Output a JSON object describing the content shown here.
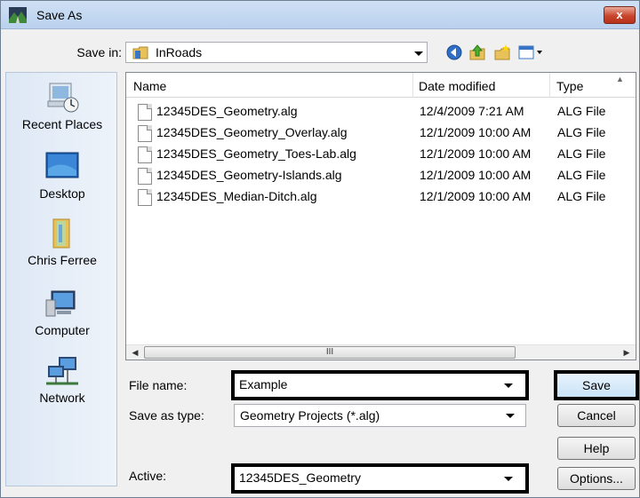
{
  "window": {
    "title": "Save As",
    "close_label": "x"
  },
  "save_in": {
    "label": "Save in:",
    "value": "InRoads"
  },
  "places": [
    {
      "label": "Recent Places",
      "icon": "recent-places-icon"
    },
    {
      "label": "Desktop",
      "icon": "desktop-icon"
    },
    {
      "label": "Chris Ferree",
      "icon": "user-folder-icon"
    },
    {
      "label": "Computer",
      "icon": "computer-icon"
    },
    {
      "label": "Network",
      "icon": "network-icon"
    }
  ],
  "columns": {
    "name": "Name",
    "date": "Date modified",
    "type": "Type"
  },
  "files": [
    {
      "name": "12345DES_Geometry.alg",
      "date": "12/4/2009 7:21 AM",
      "type": "ALG File"
    },
    {
      "name": "12345DES_Geometry_Overlay.alg",
      "date": "12/1/2009 10:00 AM",
      "type": "ALG File"
    },
    {
      "name": "12345DES_Geometry_Toes-Lab.alg",
      "date": "12/1/2009 10:00 AM",
      "type": "ALG File"
    },
    {
      "name": "12345DES_Geometry-Islands.alg",
      "date": "12/1/2009 10:00 AM",
      "type": "ALG File"
    },
    {
      "name": "12345DES_Median-Ditch.alg",
      "date": "12/1/2009 10:00 AM",
      "type": "ALG File"
    }
  ],
  "scroll_thumb_grip": "III",
  "form": {
    "file_name_label": "File name:",
    "file_name_value": "Example",
    "save_as_type_label": "Save as type:",
    "save_as_type_value": "Geometry Projects (*.alg)",
    "active_label": "Active:",
    "active_value": "12345DES_Geometry"
  },
  "buttons": {
    "save": "Save",
    "cancel": "Cancel",
    "help": "Help",
    "options": "Options..."
  },
  "colors": {
    "highlight_border": "#000000",
    "places_bg": "#dde8f5",
    "titlebar": "#cfe0f4"
  }
}
